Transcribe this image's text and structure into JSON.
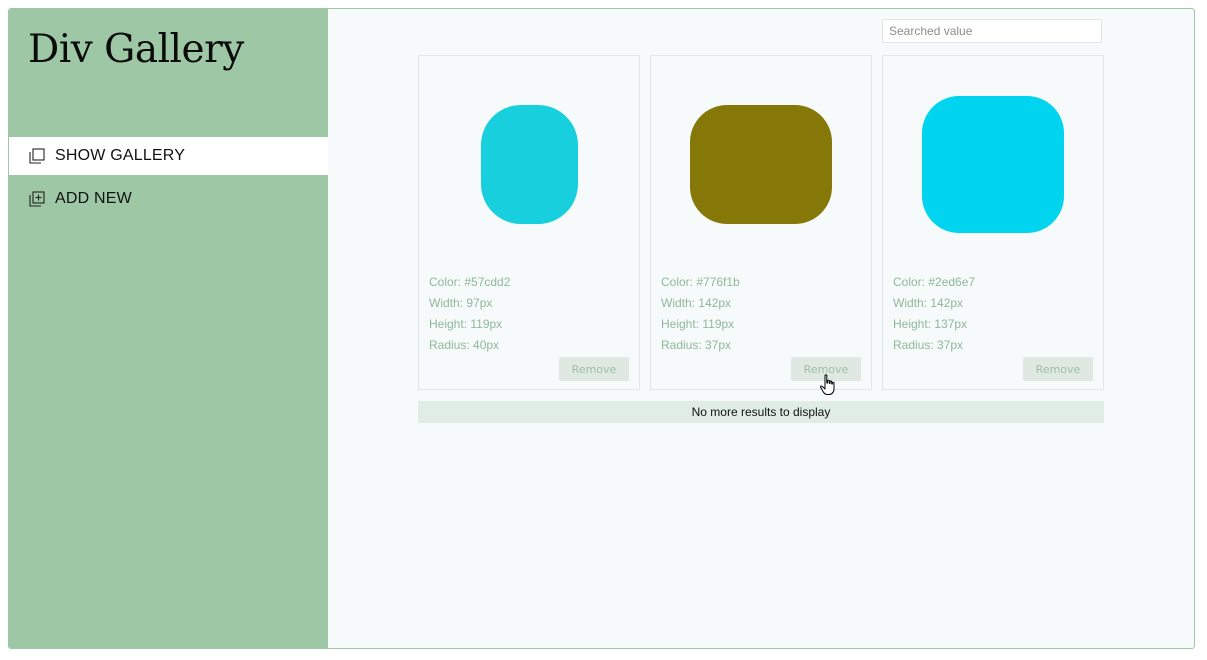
{
  "app": {
    "title": "Div Gallery"
  },
  "nav": [
    {
      "label": "SHOW GALLERY",
      "icon": "gallery-icon",
      "active": true
    },
    {
      "label": "ADD NEW",
      "icon": "add-square-icon",
      "active": false
    }
  ],
  "search": {
    "placeholder": "Searched value",
    "value": ""
  },
  "cards": [
    {
      "color": "#57cdd2",
      "color_text": "Color: #57cdd2",
      "width_text": "Width: 97px",
      "height_text": "Height: 119px",
      "radius_text": "Radius: 40px",
      "remove_label": "Remove"
    },
    {
      "color": "#776f1b",
      "color_text": "Color: #776f1b",
      "width_text": "Width: 142px",
      "height_text": "Height: 119px",
      "radius_text": "Radius: 37px",
      "remove_label": "Remove"
    },
    {
      "color": "#2ed6e7",
      "color_text": "Color: #2ed6e7",
      "width_text": "Width: 142px",
      "height_text": "Height: 137px",
      "radius_text": "Radius: 37px",
      "remove_label": "Remove"
    }
  ],
  "status": {
    "no_more": "No more results to display"
  },
  "colors": {
    "sidebar": "#9ec8a5",
    "accent_text": "#8fb79a",
    "button_bg": "#dfe9e2"
  }
}
